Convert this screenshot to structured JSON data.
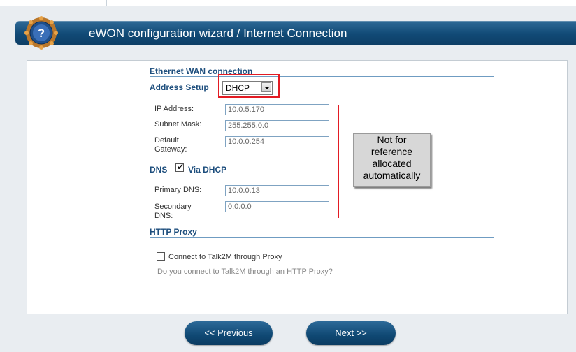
{
  "header": {
    "title": "eWON configuration wizard / Internet Connection",
    "help_icon": "question-circle-icon"
  },
  "ethernet": {
    "title": "Ethernet WAN connection"
  },
  "address_setup": {
    "label": "Address Setup",
    "value": "DHCP"
  },
  "fields": {
    "ip_label": "IP Address:",
    "ip_value": "10.0.5.170",
    "mask_label": "Subnet Mask:",
    "mask_value": "255.255.0.0",
    "gateway_label_1": "Default",
    "gateway_label_2": "Gateway:",
    "gateway_value": "10.0.0.254"
  },
  "dns": {
    "label": "DNS",
    "via_dhcp": "Via DHCP",
    "checked": true,
    "primary_label": "Primary DNS:",
    "primary_value": "10.0.0.13",
    "secondary_label_1": "Secondary",
    "secondary_label_2": "DNS:",
    "secondary_value": "0.0.0.0"
  },
  "note": {
    "line1": "Not for",
    "line2": "reference",
    "line3": "allocated",
    "line4": "automatically"
  },
  "proxy": {
    "title": "HTTP Proxy",
    "checkbox_label": "Connect to Talk2M through Proxy",
    "checked": false,
    "hint": "Do you connect to Talk2M through an HTTP Proxy?"
  },
  "nav": {
    "previous": "<< Previous",
    "next": "Next >>"
  },
  "colors": {
    "accent": "#1d4e7d",
    "title_bar": "#114a76",
    "highlight": "#e31b23"
  }
}
